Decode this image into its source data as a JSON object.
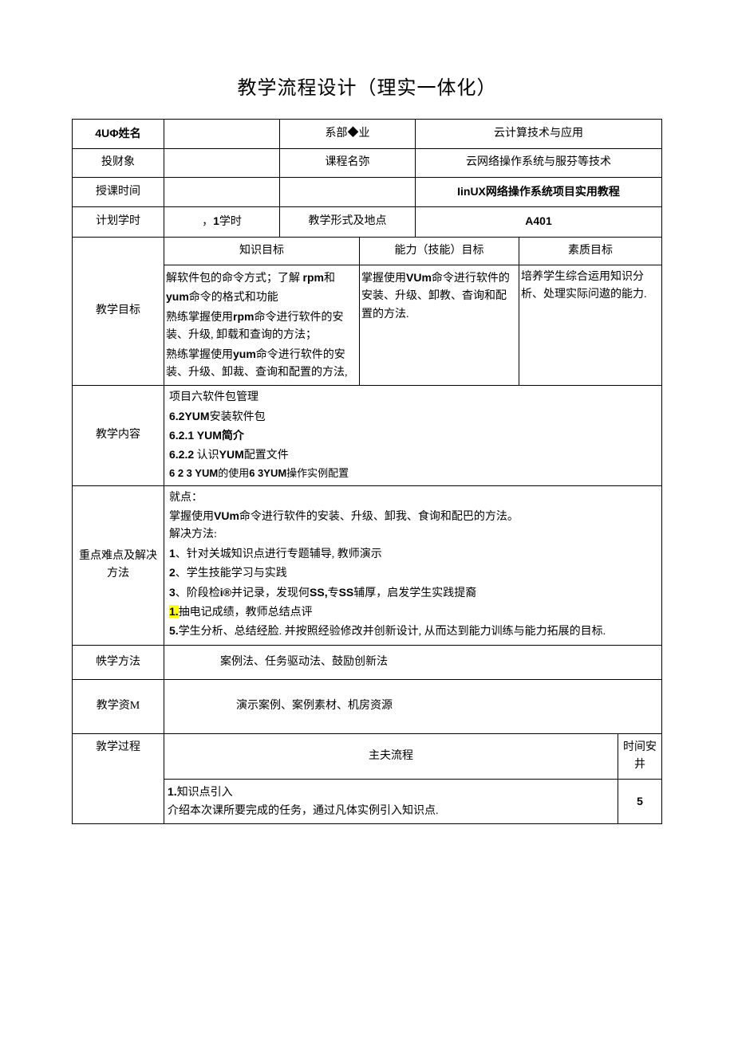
{
  "title": "教学流程设计（理实一体化）",
  "row1": {
    "label": "4UΦ姓名",
    "val1": "",
    "label2": "系部◆业",
    "val2": "云计算技术与应用"
  },
  "row2": {
    "label": "投财象",
    "val1": "",
    "label2": "课程名弥",
    "val2": "云网络操作系统与服芬等技术"
  },
  "row3": {
    "label": "授课时间",
    "val1": "",
    "label2": "",
    "val2": "IinUX网络操作系统项目实用教程"
  },
  "row4": {
    "label": "计划学时",
    "val1": "，1学时",
    "label2": "教学形式及地点",
    "val2": "A401"
  },
  "goals": {
    "rowlabel": "教学目标",
    "h1": "知识目标",
    "h2": "能力（技能）目标",
    "h3": "素质目标",
    "c1a": "解软件包的命令方式；了解",
    "c1b": "rpm",
    "c1c": "和",
    "c1d": "yum",
    "c1e": "命令的格式和功能",
    "c1f": "熟练掌握使用",
    "c1g": "rpm",
    "c1h": "命令进行软件的安装、升级, 卸载和查询的方法；",
    "c1i": "熟练掌握使用",
    "c1j": "yum",
    "c1k": "命令进行软件的安装、升级、卸裁、查询和配置的方法,",
    "c2a": "掌握使用",
    "c2b": "VUm",
    "c2c": "命令进行软件的安装、升级、卸教、杳询和配置的方法.",
    "c3": "培养学生综合运用知识分析、处理实际问遨的能力."
  },
  "content": {
    "label": "教学内容",
    "l1": "项目六软件包管理",
    "l2a": "6.2YUM",
    "l2b": "安装软件包",
    "l3": "6.2.1 YUM简介",
    "l4a": "6.2.2",
    "l4b": " 认识",
    "l4c": "YUM",
    "l4d": "配置文件",
    "l5a": "6 2 3 YUM",
    "l5b": "的使用",
    "l5c": "6 3YUM",
    "l5d": "操作实例配置"
  },
  "keypoints": {
    "label": "重点难点及解决方法",
    "p1": "就点：",
    "p2a": "掌握使用",
    "p2b": "VUm",
    "p2c": "命令进行软件的安装、升级、卸我、食询和配巴的方法。",
    "p3": "解决方法:",
    "p4a": "1",
    "p4b": "、针对关城知识点进行专题辅导, 教师演示",
    "p5a": "2",
    "p5b": "、学生技能学习与实践",
    "p6a": "3",
    "p6b": "、阶段检",
    "p6c": "i®",
    "p6d": "并记录，发现何",
    "p6e": "SS,",
    "p6f": "专",
    "p6g": "SS",
    "p6h": "辅厚，启发学生实践提裔",
    "p7a": "1.",
    "p7b": "抽电记成绩，教师总结点评",
    "p8a": "5.",
    "p8b": "学生分析、总结经脸. 并按照经验修改并创新设计, 从而达到能力训练与能力拓展的目标."
  },
  "method": {
    "label": "帙学方法",
    "val": "案例法、任务驱动法、鼓励创新法"
  },
  "resource": {
    "label": "教学资M",
    "val": "演示案例、案例素材、机房资源"
  },
  "process": {
    "label": "敦学过程",
    "mainhead": "主夫流程",
    "timehead": "时间安井",
    "step1a": "1.",
    "step1b": "知识点引入",
    "step1c": "介绍本次课所要完成的任务，通过凡体实例引入知识点.",
    "time1": "5"
  }
}
